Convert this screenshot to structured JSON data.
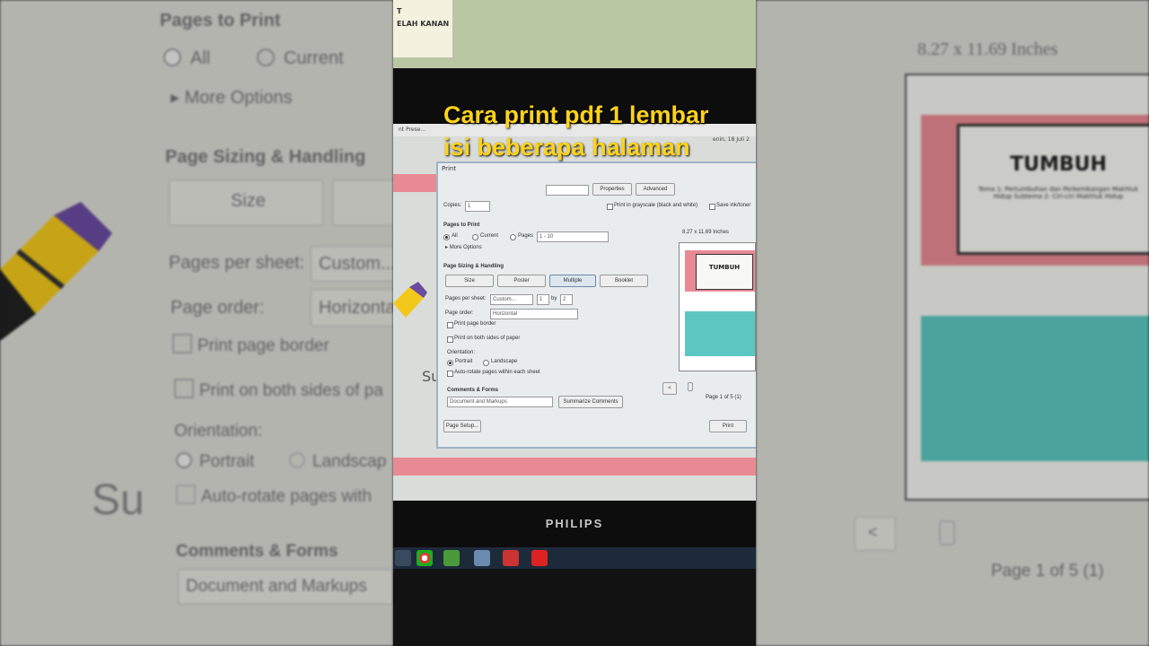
{
  "caption": "Cara print pdf 1 lembar isi beberapa halaman",
  "monitor_brand": "PHILIPS",
  "note_paper": {
    "line1": "T",
    "line2": "ELAH KANAN"
  },
  "bg_left": {
    "pages_to_print": "Pages to Print",
    "all": "All",
    "current": "Current",
    "more_options": "More Options",
    "page_sizing": "Page Sizing & Handling",
    "size_btn": "Size",
    "pages_per_sheet": "Pages per sheet:",
    "pps_value": "Custom...",
    "page_order": "Page order:",
    "page_order_value": "Horizonta",
    "print_border": "Print page border",
    "both_sides": "Print on both sides of pa",
    "orientation": "Orientation:",
    "portrait": "Portrait",
    "landscape": "Landscap",
    "auto_rotate": "Auto-rotate pages with",
    "comments_forms": "Comments & Forms",
    "cf_value": "Document and Markups",
    "su": "Su"
  },
  "bg_right": {
    "paper_size": "8.27 x 11.69 Inches",
    "preview_title": "TUMBUH",
    "preview_sub": "Tema 1: Pertumbuhan dan Perkembangan Makhluk Hidup Subtema 2: Ciri-ciri Makhluk Hidup",
    "page_info": "Page 1 of 5 (1)",
    "nav_prev": "<"
  },
  "dialog": {
    "title": "Print",
    "properties": "Properties",
    "advanced": "Advanced",
    "copies_label": "Copies:",
    "copies_value": "1",
    "grayscale": "Print in grayscale (black and white)",
    "save_ink": "Save ink/toner",
    "pages_to_print": "Pages to Print",
    "all": "All",
    "current": "Current",
    "pages": "Pages",
    "pages_range": "1 - 10",
    "more_options": "More Options",
    "page_sizing": "Page Sizing & Handling",
    "size": "Size",
    "poster": "Poster",
    "multiple": "Multiple",
    "booklet": "Booklet",
    "pps_label": "Pages per sheet:",
    "pps_value": "Custom...",
    "pps_x": "1",
    "pps_by": "by",
    "pps_y": "2",
    "order_label": "Page order:",
    "order_value": "Horizontal",
    "print_border": "Print page border",
    "both_sides": "Print on both sides of paper",
    "orientation": "Orientation:",
    "portrait": "Portrait",
    "landscape": "Landscape",
    "auto_rotate": "Auto-rotate pages within each sheet",
    "comments_forms": "Comments & Forms",
    "cf_value": "Document and Markups",
    "summarize": "Summarize Comments",
    "page_setup": "Page Setup...",
    "print_btn": "Print",
    "paper_size": "8.27 x 11.69 Inches",
    "preview_title": "TUMBUH",
    "page_info": "Page 1 of 5 (1)",
    "date": "enin, 18 Juli 2",
    "tab_text": "nt Prese..."
  },
  "colors": {
    "caption": "#ffd31a",
    "pink": "#e88a93",
    "teal": "#5cc7c0"
  }
}
